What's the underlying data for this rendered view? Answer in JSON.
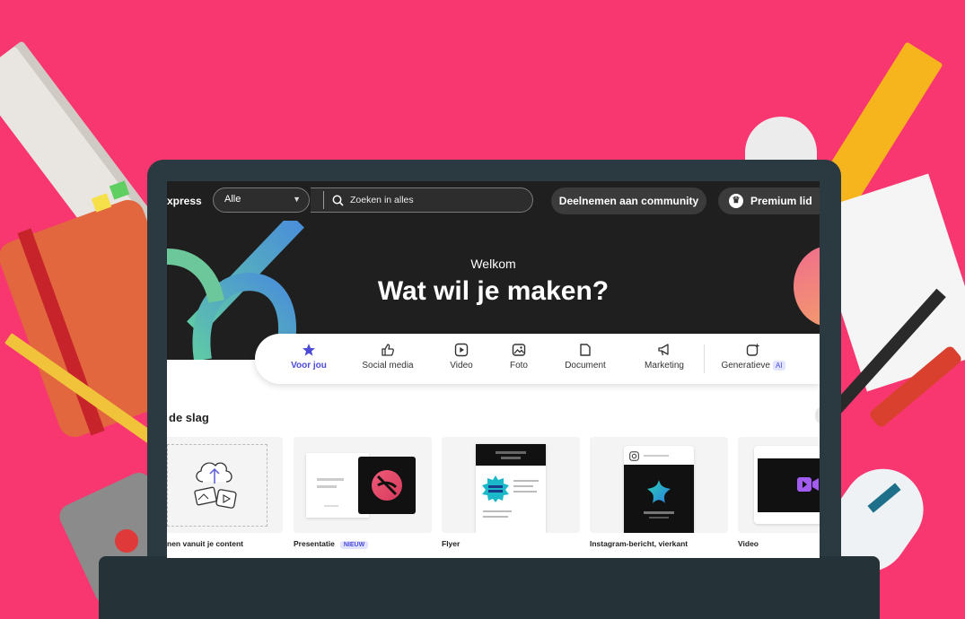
{
  "topbar": {
    "brand": "xpress",
    "filter_value": "Alle",
    "search_placeholder": "Zoeken in alles",
    "community_label": "Deelnemen aan community",
    "premium_label": "Premium lid"
  },
  "hero": {
    "welcome": "Welkom",
    "headline": "Wat wil je maken?"
  },
  "categories": [
    {
      "label": "Voor jou",
      "icon": "star-icon",
      "active": true
    },
    {
      "label": "Social media",
      "icon": "thumbs-up-icon"
    },
    {
      "label": "Video",
      "icon": "play-icon"
    },
    {
      "label": "Foto",
      "icon": "image-icon"
    },
    {
      "label": "Document",
      "icon": "document-icon"
    },
    {
      "label": "Marketing",
      "icon": "megaphone-icon"
    },
    {
      "label": "Generatieve",
      "icon": "sparkle-icon",
      "badge": "AI"
    }
  ],
  "section": {
    "title": "de slag"
  },
  "cards": [
    {
      "label": "nen vanuit je content"
    },
    {
      "label": "Presentatie",
      "badge": "NIEUW"
    },
    {
      "label": "Flyer"
    },
    {
      "label": "Instagram-bericht, vierkant"
    },
    {
      "label": "Video"
    }
  ],
  "colors": {
    "background": "#f8366f",
    "accent": "#4b4bd8",
    "topbar": "#1f1f1f"
  }
}
